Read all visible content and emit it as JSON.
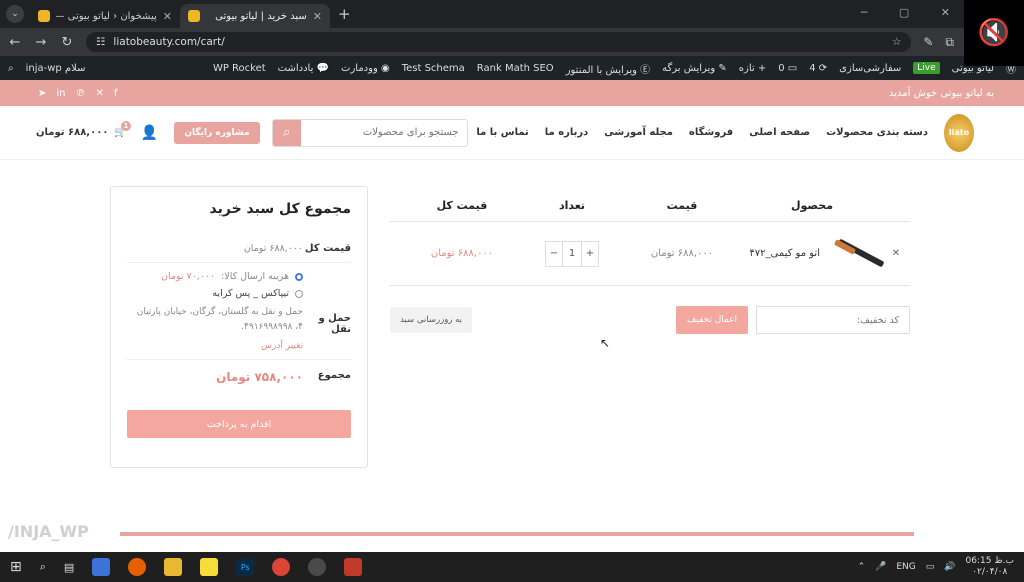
{
  "browser": {
    "tabs": [
      {
        "title": "پیشخوان ‹ لیاتو بیوتی — وردپرس",
        "active": false
      },
      {
        "title": "سبد خرید | لیاتو بیوتی",
        "active": true
      }
    ],
    "url": "liatobeauty.com/cart/",
    "controls": "─ ▢ ✕"
  },
  "adminbar": {
    "site_name": "لیاتو بیوتی",
    "live": "Live",
    "customize": "سفارشی‌سازی",
    "updates": "4",
    "comments": "0",
    "new": "تازه",
    "edit_page": "ویرایش برگه",
    "edit_elementor": "ویرایش با المنتور",
    "rank_math": "Rank Math SEO",
    "test_schema": "Test Schema",
    "woodmart": "وودمارت",
    "notes": "یادداشت",
    "wp_rocket": "WP Rocket",
    "greeting": "سلام inja-wp"
  },
  "topstrip": {
    "welcome": "به لیاتو بیوتی خوش آمدید"
  },
  "header": {
    "logo_text": "liato",
    "menu": [
      "دسته بندی محصولات",
      "صفحه اصلی",
      "فروشگاه",
      "مجله آموزشی",
      "درباره ما",
      "تماس با ما"
    ],
    "search_placeholder": "جستجو برای محصولات",
    "consult_button": "مشاوره رایگان",
    "cart_total": "۶۸۸,۰۰۰ تومان",
    "cart_count": "1"
  },
  "cart": {
    "headers": {
      "product": "محصول",
      "price": "قیمت",
      "quantity": "تعداد",
      "subtotal": "قیمت کل"
    },
    "items": [
      {
        "name": "اتو مو کیمی_۴۷۲",
        "price": "۶۸۸,۰۰۰ تومان",
        "qty": "1",
        "subtotal": "۶۸۸,۰۰۰ تومان"
      }
    ],
    "coupon_placeholder": "کد تخفیف:",
    "apply_coupon": "اعمال تخفیف",
    "update_cart": "به روزرسانی سبد"
  },
  "totals": {
    "title": "مجموع کل سبد خرید",
    "subtotal_label": "قیمت کل",
    "subtotal_value": "۶۸۸,۰۰۰ تومان",
    "shipping_label": "حمل و نقل",
    "shipping_options": [
      {
        "label": "هزینه ارسال کالا:",
        "price": "۷۰,۰۰۰ تومان",
        "selected": true
      },
      {
        "label": "تیپاکس _ پس کرایه",
        "price": "",
        "selected": false
      }
    ],
    "shipping_note": "حمل و نقل به گلستان، گرگان، خیابان پارتیان ۴، ۴۹۱۶۹۹۸۹۹۸.",
    "change_address": "تغییر آدرس",
    "total_label": "مجموع",
    "total_value": "۷۵۸,۰۰۰ تومان",
    "checkout": "اقدام به پرداخت"
  },
  "watermark": "/INJA_WP",
  "taskbar": {
    "lang": "ENG",
    "time": "06:15 ب.ظ",
    "date": "۰۲/۰۴/۰۸"
  }
}
